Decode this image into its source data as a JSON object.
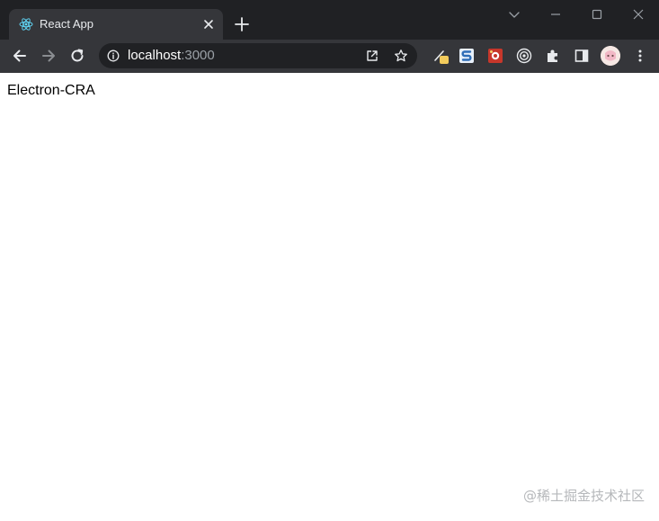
{
  "browser": {
    "tab": {
      "title": "React App",
      "favicon": "react-logo-icon"
    },
    "address_bar": {
      "host": "localhost",
      "port": ":3000"
    },
    "extensions": [
      "pen-extension-icon",
      "s-extension-icon",
      "red-extension-icon",
      "target-extension-icon"
    ],
    "colors": {
      "tab_strip": "#202124",
      "toolbar": "#35363a",
      "omnibox": "#202124",
      "react_blue": "#61dafb"
    }
  },
  "page": {
    "text": "Electron-CRA"
  },
  "watermark": "@稀土掘金技术社区"
}
